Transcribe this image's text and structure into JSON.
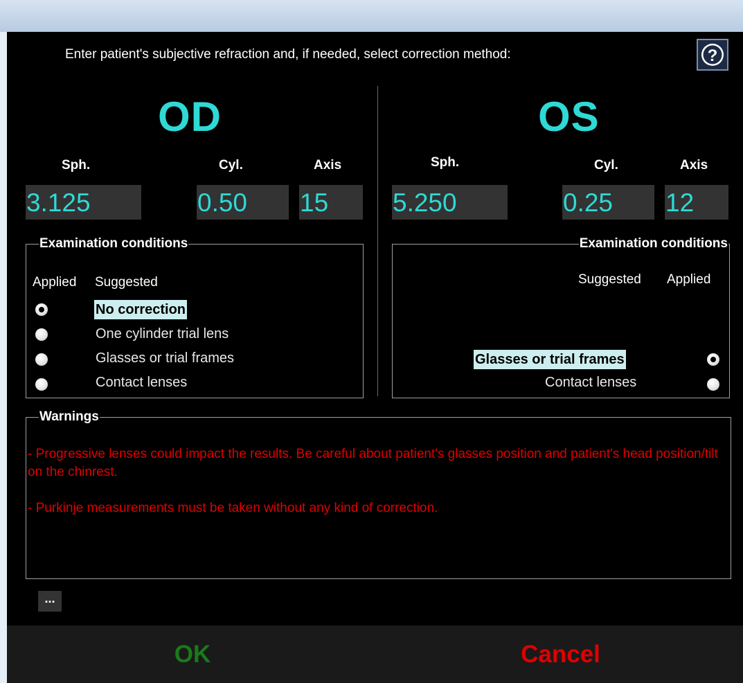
{
  "instruction": "Enter patient's subjective refraction and, if needed, select correction method:",
  "help_icon": "question-mark-icon",
  "od": {
    "title": "OD",
    "sph_label": "Sph.",
    "cyl_label": "Cyl.",
    "axis_label": "Axis",
    "sph": "3.125",
    "cyl": "0.50",
    "axis": "15",
    "conditions": {
      "legend": "Examination conditions",
      "applied_label": "Applied",
      "suggested_label": "Suggested",
      "options": [
        {
          "label": "No correction",
          "checked": true,
          "suggested": true
        },
        {
          "label": "One cylinder trial lens",
          "checked": false,
          "suggested": false
        },
        {
          "label": "Glasses or trial frames",
          "checked": false,
          "suggested": false
        },
        {
          "label": "Contact lenses",
          "checked": false,
          "suggested": false
        }
      ]
    }
  },
  "os": {
    "title": "OS",
    "sph_label": "Sph.",
    "cyl_label": "Cyl.",
    "axis_label": "Axis",
    "sph": "5.250",
    "cyl": "0.25",
    "axis": "12",
    "conditions": {
      "legend": "Examination conditions",
      "suggested_label": "Suggested",
      "applied_label": "Applied",
      "options": [
        {
          "label": "Glasses or trial frames",
          "checked": true,
          "suggested": true
        },
        {
          "label": "Contact lenses",
          "checked": false,
          "suggested": false
        }
      ]
    }
  },
  "warnings": {
    "legend": "Warnings",
    "lines": [
      "- Progressive lenses could impact the results. Be careful about patient's glasses position and patient's head position/tilt on the chinrest.",
      "- Purkinje measurements must be taken without any kind of correction."
    ]
  },
  "more_button": "...",
  "footer": {
    "ok": "OK",
    "cancel": "Cancel"
  },
  "colors": {
    "accent": "#2fd9d5",
    "warning": "#e00000",
    "ok": "#1a7a1a",
    "cancel": "#e00000",
    "highlight": "#cdeeee",
    "background": "#000000"
  }
}
